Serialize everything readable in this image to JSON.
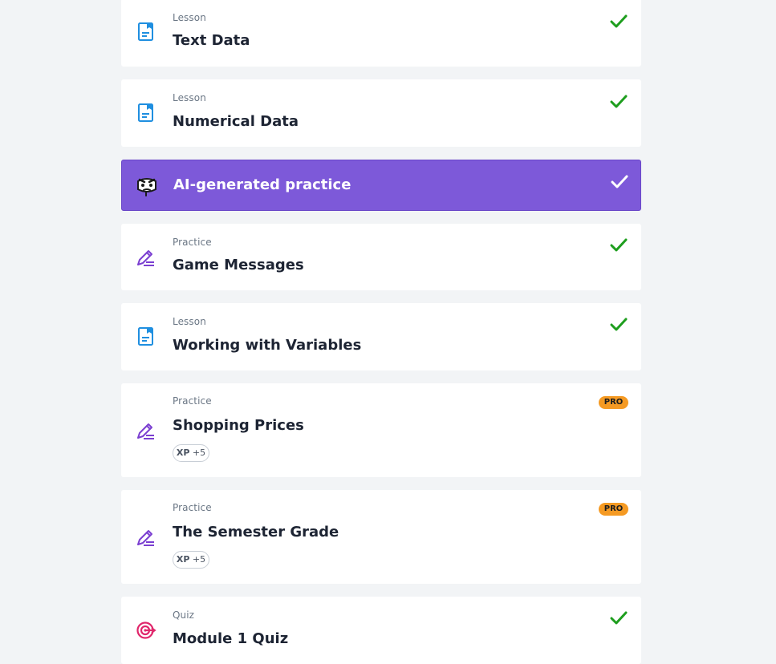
{
  "items": [
    {
      "kind": "Lesson",
      "title": "Text Data",
      "icon": "lesson-document-icon",
      "status": "completed"
    },
    {
      "kind": "Lesson",
      "title": "Numerical Data",
      "icon": "lesson-document-icon",
      "status": "completed"
    },
    {
      "kind": "",
      "title": "AI-generated practice",
      "icon": "ai-mascot-icon",
      "status": "completed"
    },
    {
      "kind": "Practice",
      "title": "Game Messages",
      "icon": "practice-pencil-icon",
      "status": "completed"
    },
    {
      "kind": "Lesson",
      "title": "Working with Variables",
      "icon": "lesson-document-icon",
      "status": "completed"
    },
    {
      "kind": "Practice",
      "title": "Shopping Prices",
      "icon": "practice-pencil-icon",
      "badge": "PRO",
      "xp_label": "XP",
      "xp_value": "+5"
    },
    {
      "kind": "Practice",
      "title": "The Semester Grade",
      "icon": "practice-pencil-icon",
      "badge": "PRO",
      "xp_label": "XP",
      "xp_value": "+5"
    },
    {
      "kind": "Quiz",
      "title": "Module 1 Quiz",
      "icon": "quiz-target-icon",
      "status": "completed"
    }
  ],
  "colors": {
    "background": "#f2f4f6",
    "card": "#ffffff",
    "ai_accent": "#7d59d9",
    "check_green": "#1e9e1e",
    "lesson_blue": "#1f8fe0",
    "practice_purple": "#7b3fd1",
    "quiz_pink": "#e0266b",
    "pro_orange": "#f59a23"
  }
}
